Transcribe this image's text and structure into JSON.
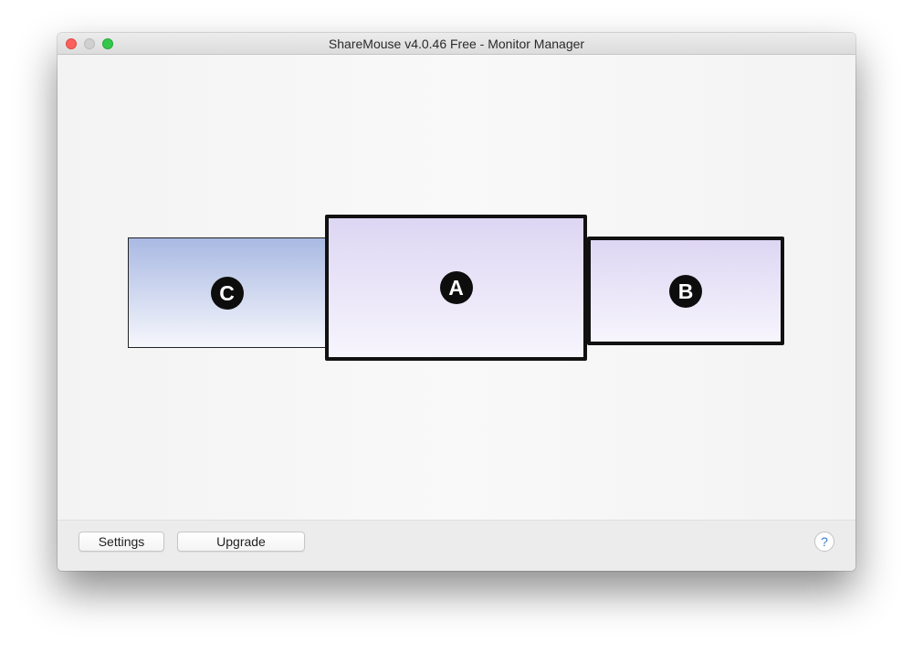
{
  "window": {
    "title": "ShareMouse v4.0.46 Free - Monitor Manager"
  },
  "monitors": [
    {
      "id": "C",
      "label": "C",
      "gradient_top": "#a9b9e3",
      "gradient_bottom": "#f6f7fc"
    },
    {
      "id": "A",
      "label": "A",
      "gradient_top": "#ddd6f3",
      "gradient_bottom": "#f7f5fd"
    },
    {
      "id": "B",
      "label": "B",
      "gradient_top": "#ddd6f3",
      "gradient_bottom": "#f7f5fd"
    }
  ],
  "footer": {
    "settings_label": "Settings",
    "upgrade_label": "Upgrade",
    "help_label": "?"
  },
  "icons": {
    "close": "close-icon",
    "minimize": "minimize-icon",
    "zoom": "zoom-icon",
    "help": "help-icon"
  },
  "colors": {
    "close": "#fc605c",
    "minimize": "#d0d0d0",
    "zoom": "#34c84a",
    "help_accent": "#3a7bd5"
  }
}
